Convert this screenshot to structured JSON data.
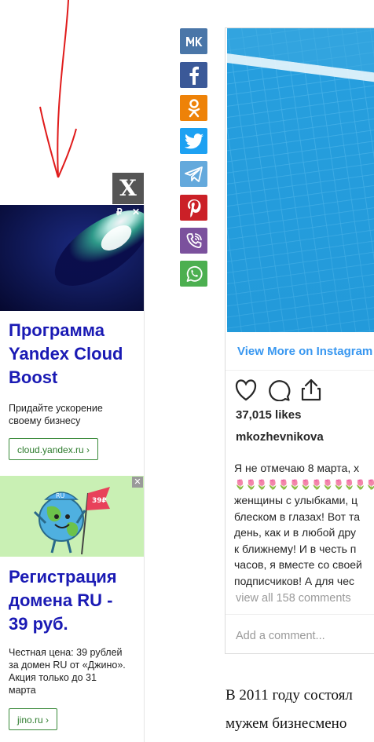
{
  "close_ad_label": "X",
  "share": [
    {
      "name": "vk",
      "icon": "vk-icon",
      "color": "#4a76a8"
    },
    {
      "name": "facebook",
      "icon": "facebook-icon",
      "color": "#3b5998"
    },
    {
      "name": "odnoklassniki",
      "icon": "odnoklassniki-icon",
      "color": "#ee8208"
    },
    {
      "name": "twitter",
      "icon": "twitter-icon",
      "color": "#1da1f2"
    },
    {
      "name": "telegram",
      "icon": "telegram-icon",
      "color": "#64a9dc"
    },
    {
      "name": "pinterest",
      "icon": "pinterest-icon",
      "color": "#cb2027"
    },
    {
      "name": "viber",
      "icon": "viber-icon",
      "color": "#7b519d"
    },
    {
      "name": "whatsapp",
      "icon": "whatsapp-icon",
      "color": "#4caf50"
    }
  ],
  "ads": [
    {
      "title_lines": [
        "Программа",
        "Yandex Cloud",
        "Boost"
      ],
      "desc_lines": [
        "Придайте ускорение",
        "своему бизнесу"
      ],
      "button": "cloud.yandex.ru ›",
      "corner_marks": [
        "₽",
        "✕"
      ]
    },
    {
      "title_lines": [
        "Регистрация",
        "домена RU -",
        "39 руб."
      ],
      "desc_lines": [
        "Честная цена: 39 рублей",
        "за домен RU от «Джино».",
        "Акция только до 31",
        "марта"
      ],
      "button": "jino.ru ›",
      "corner_mark": "✕",
      "flag_text": "39₽",
      "cap_text": "RU"
    }
  ],
  "instagram": {
    "view_more": "View More on Instagram",
    "likes": "37,015 likes",
    "username": "mkozhevnikova",
    "caption_lines": [
      "Я не отмечаю 8 марта, х",
      "🌷🌷🌷🌷🌷🌷🌷🌷🌷🌷🌷🌷🌷",
      "женщины с улыбками, ц",
      "блеском в глазах! Вот та",
      "день, как и в любой дру",
      "к ближнему! И в честь п",
      "часов, я вместе со своей",
      "подписчиков! А для чес"
    ],
    "comments": "view all 158 comments",
    "add_comment": "Add a comment..."
  },
  "article_lines": [
    "В 2011 году состоял",
    "мужем бизнесмено"
  ]
}
